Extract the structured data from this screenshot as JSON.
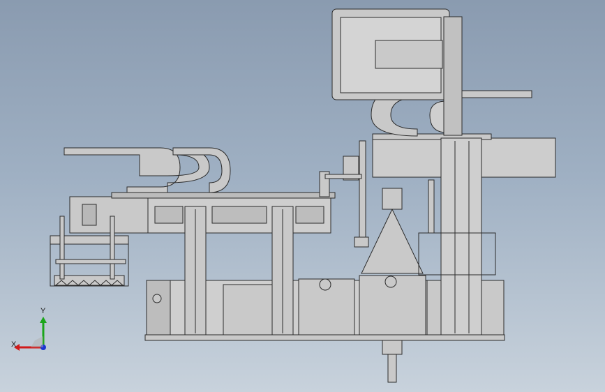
{
  "viewport": {
    "background_top": "#8a9bb0",
    "background_bottom": "#c8d2dc"
  },
  "model": {
    "part_fill": "#c9c9c9",
    "part_fill_light": "#d4d4d4",
    "part_fill_dark": "#9a9a9a",
    "edge_color": "#2b2b2b"
  },
  "triad": {
    "x_label": "X",
    "y_label": "Y",
    "x_color": "#d11a1a",
    "y_color": "#1aa51a",
    "z_color": "#1a35d1"
  }
}
